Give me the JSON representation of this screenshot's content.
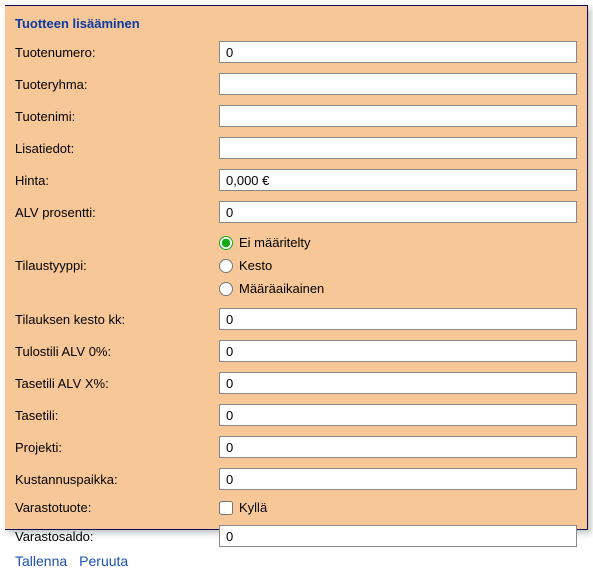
{
  "title": "Tuotteen lisääminen",
  "fields": {
    "tuotenumero": {
      "label": "Tuotenumero:",
      "value": "0"
    },
    "tuoteryhma": {
      "label": "Tuoteryhma:",
      "value": ""
    },
    "tuotenimi": {
      "label": "Tuotenimi:",
      "value": ""
    },
    "lisatiedot": {
      "label": "Lisatiedot:",
      "value": ""
    },
    "hinta": {
      "label": "Hinta:",
      "value": "0,000 €"
    },
    "alv_prosentti": {
      "label": "ALV prosentti:",
      "value": "0"
    },
    "tilaustyyppi": {
      "label": "Tilaustyyppi:"
    },
    "tilauksen_kesto": {
      "label": "Tilauksen kesto kk:",
      "value": "0"
    },
    "tulostili_alv0": {
      "label": "Tulostili ALV 0%:",
      "value": "0"
    },
    "tasetili_alvx": {
      "label": "Tasetili ALV X%:",
      "value": "0"
    },
    "tasetili": {
      "label": "Tasetili:",
      "value": "0"
    },
    "projekti": {
      "label": "Projekti:",
      "value": "0"
    },
    "kustannuspaikka": {
      "label": "Kustannuspaikka:",
      "value": "0"
    },
    "varastotuote": {
      "label": "Varastotuote:",
      "checkbox_label": "Kyllä",
      "checked": false
    },
    "varastosaldo": {
      "label": "Varastosaldo:",
      "value": "0"
    }
  },
  "tilaustyyppi_options": {
    "ei_maaritelty": {
      "label": "Ei määritelty",
      "selected": true
    },
    "kesto": {
      "label": "Kesto",
      "selected": false
    },
    "maaraaikainen": {
      "label": "Määräaikainen",
      "selected": false
    }
  },
  "actions": {
    "save": {
      "label": "Tallenna"
    },
    "cancel": {
      "label": "Peruuta"
    }
  }
}
